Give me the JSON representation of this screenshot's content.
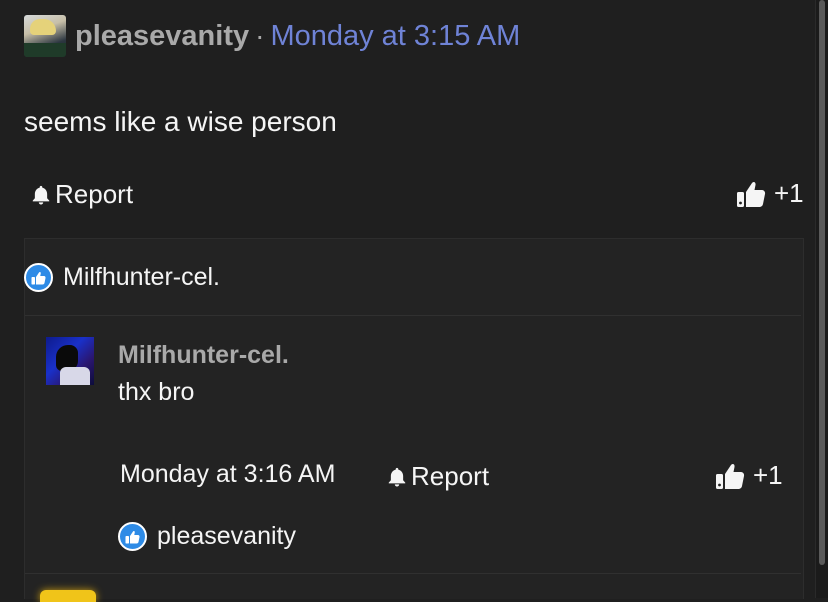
{
  "post": {
    "username": "pleasevanity",
    "separator": "·",
    "timestamp": "Monday at 3:15 AM",
    "body": "seems like a wise person",
    "report_label": "Report",
    "like_count": "+1"
  },
  "reactions": {
    "users": [
      "Milfhunter-cel."
    ]
  },
  "reply": {
    "username": "Milfhunter-cel.",
    "body": "thx bro",
    "timestamp": "Monday at 3:16 AM",
    "report_label": "Report",
    "like_count": "+1",
    "reaction_users": [
      "pleasevanity"
    ]
  },
  "colors": {
    "background": "#1f1f1f",
    "username": "#a9a9a9",
    "timestamp_link": "#6f83d6",
    "like_badge": "#2e8be6"
  },
  "icons": {
    "report": "bell-icon",
    "like": "thumbs-up-icon",
    "reaction_badge": "like-badge-icon"
  }
}
